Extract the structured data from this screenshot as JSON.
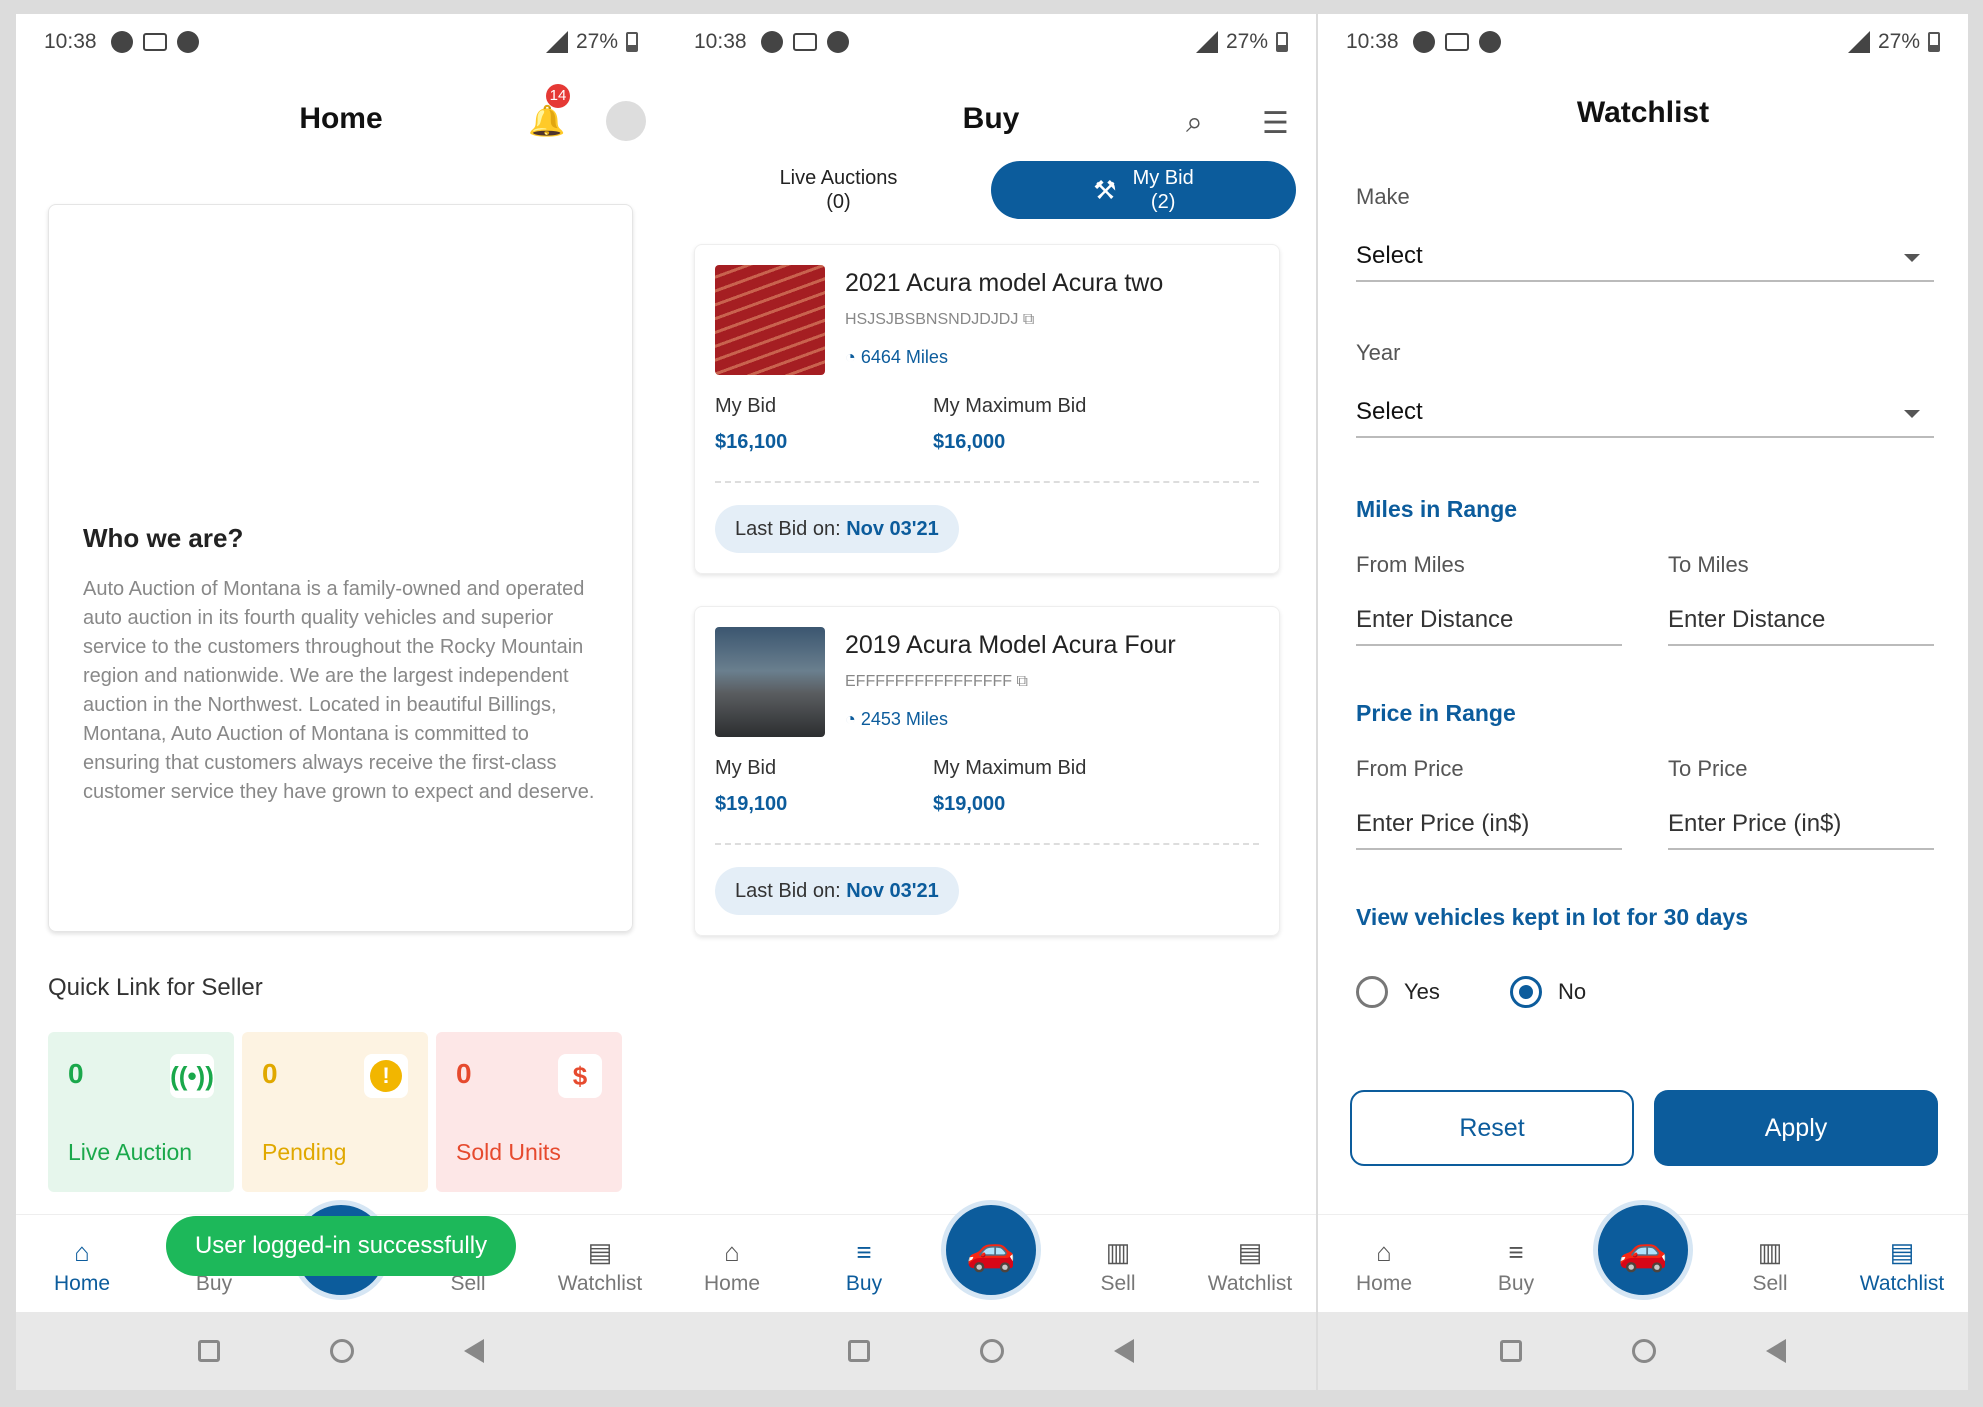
{
  "status": {
    "time": "10:38",
    "battery": "27%"
  },
  "nav": {
    "home": "Home",
    "buy": "Buy",
    "sell": "Sell",
    "watchlist": "Watchlist"
  },
  "home": {
    "title": "Home",
    "notif_count": "14",
    "about_title": "Who we are?",
    "about_text": "Auto Auction of Montana is a family-owned and operated auto auction in its fourth quality vehicles and superior service to the customers throughout the Rocky Mountain region and nationwide. We are the largest independent auction in the Northwest. Located in beautiful Billings, Montana, Auto Auction of Montana is committed to ensuring that customers always receive the first-class customer service they have grown to expect and deserve.",
    "quick_title": "Quick Link for Seller",
    "quick": [
      {
        "count": "0",
        "label": "Live Auction",
        "color": "#1aa84b",
        "bg": "#e6f6ec",
        "icon": "live-signal-icon"
      },
      {
        "count": "0",
        "label": "Pending",
        "color": "#e0a800",
        "bg": "#fdf3e2",
        "icon": "warning-icon"
      },
      {
        "count": "0",
        "label": "Sold Units",
        "color": "#e64a2e",
        "bg": "#fde7e7",
        "icon": "dollar-icon"
      }
    ],
    "toast": "User logged-in successfully"
  },
  "buy": {
    "title": "Buy",
    "tab_live": "Live Auctions",
    "tab_live_count": "(0)",
    "tab_bid": "My Bid",
    "tab_bid_count": "(2)",
    "labels": {
      "my_bid": "My Bid",
      "max_bid": "My Maximum Bid",
      "last_bid": "Last Bid on:"
    },
    "cards": [
      {
        "title": "2021 Acura model Acura two",
        "vin": "HSJSJBSBNSNDJDJDJ",
        "miles": "6464 Miles",
        "my_bid": "$16,100",
        "max_bid": "$16,000",
        "last_bid": "Nov 03'21"
      },
      {
        "title": "2019 Acura Model Acura Four",
        "vin": "EFFFFFFFFFFFFFFFF",
        "miles": "2453 Miles",
        "my_bid": "$19,100",
        "max_bid": "$19,000",
        "last_bid": "Nov 03'21"
      }
    ]
  },
  "watchlist": {
    "title": "Watchlist",
    "make_label": "Make",
    "make_value": "Select",
    "year_label": "Year",
    "year_value": "Select",
    "miles_section": "Miles in Range",
    "from_miles": "From Miles",
    "to_miles": "To Miles",
    "miles_placeholder": "Enter Distance",
    "price_section": "Price in Range",
    "from_price": "From Price",
    "to_price": "To Price",
    "price_placeholder": "Enter Price (in$)",
    "lot_question": "View vehicles kept in lot for 30 days",
    "yes": "Yes",
    "no": "No",
    "selected": "No",
    "reset": "Reset",
    "apply": "Apply"
  },
  "colors": {
    "primary": "#0c5c9c",
    "toast": "#1db85a"
  }
}
